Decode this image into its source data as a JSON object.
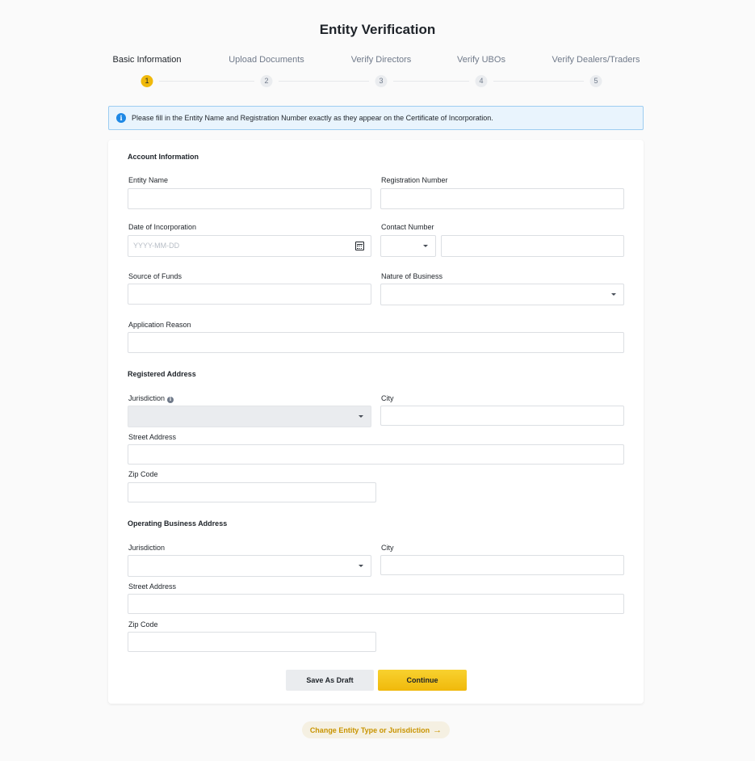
{
  "page": {
    "title": "Entity Verification"
  },
  "steps": [
    {
      "label": "Basic Information",
      "number": "1",
      "active": true
    },
    {
      "label": "Upload Documents",
      "number": "2",
      "active": false
    },
    {
      "label": "Verify Directors",
      "number": "3",
      "active": false
    },
    {
      "label": "Verify UBOs",
      "number": "4",
      "active": false
    },
    {
      "label": "Verify Dealers/Traders",
      "number": "5",
      "active": false
    }
  ],
  "notice": {
    "icon": "info-icon",
    "text": "Please fill in the Entity Name and Registration Number exactly as they appear on the Certificate of Incorporation."
  },
  "account_info": {
    "heading": "Account Information",
    "entity_name_label": "Entity Name",
    "registration_number_label": "Registration Number",
    "date_label": "Date of Incorporation",
    "date_placeholder": "YYYY-MM-DD",
    "contact_label": "Contact Number",
    "source_of_funds_label": "Source of Funds",
    "nature_of_business_label": "Nature of Business",
    "application_reason_label": "Application Reason"
  },
  "registered_address": {
    "heading": "Registered Address",
    "jurisdiction_label": "Jurisdiction",
    "city_label": "City",
    "street_label": "Street Address",
    "zip_label": "Zip Code"
  },
  "operating_address": {
    "heading": "Operating Business Address",
    "jurisdiction_label": "Jurisdiction",
    "city_label": "City",
    "street_label": "Street Address",
    "zip_label": "Zip Code"
  },
  "actions": {
    "save_draft": "Save As Draft",
    "continue": "Continue",
    "change_entity": "Change Entity Type or Jurisdiction",
    "arrow": "→"
  },
  "colors": {
    "brand": "#f0b90b",
    "notice_bg": "#e9f4fd",
    "link": "#c99400"
  }
}
